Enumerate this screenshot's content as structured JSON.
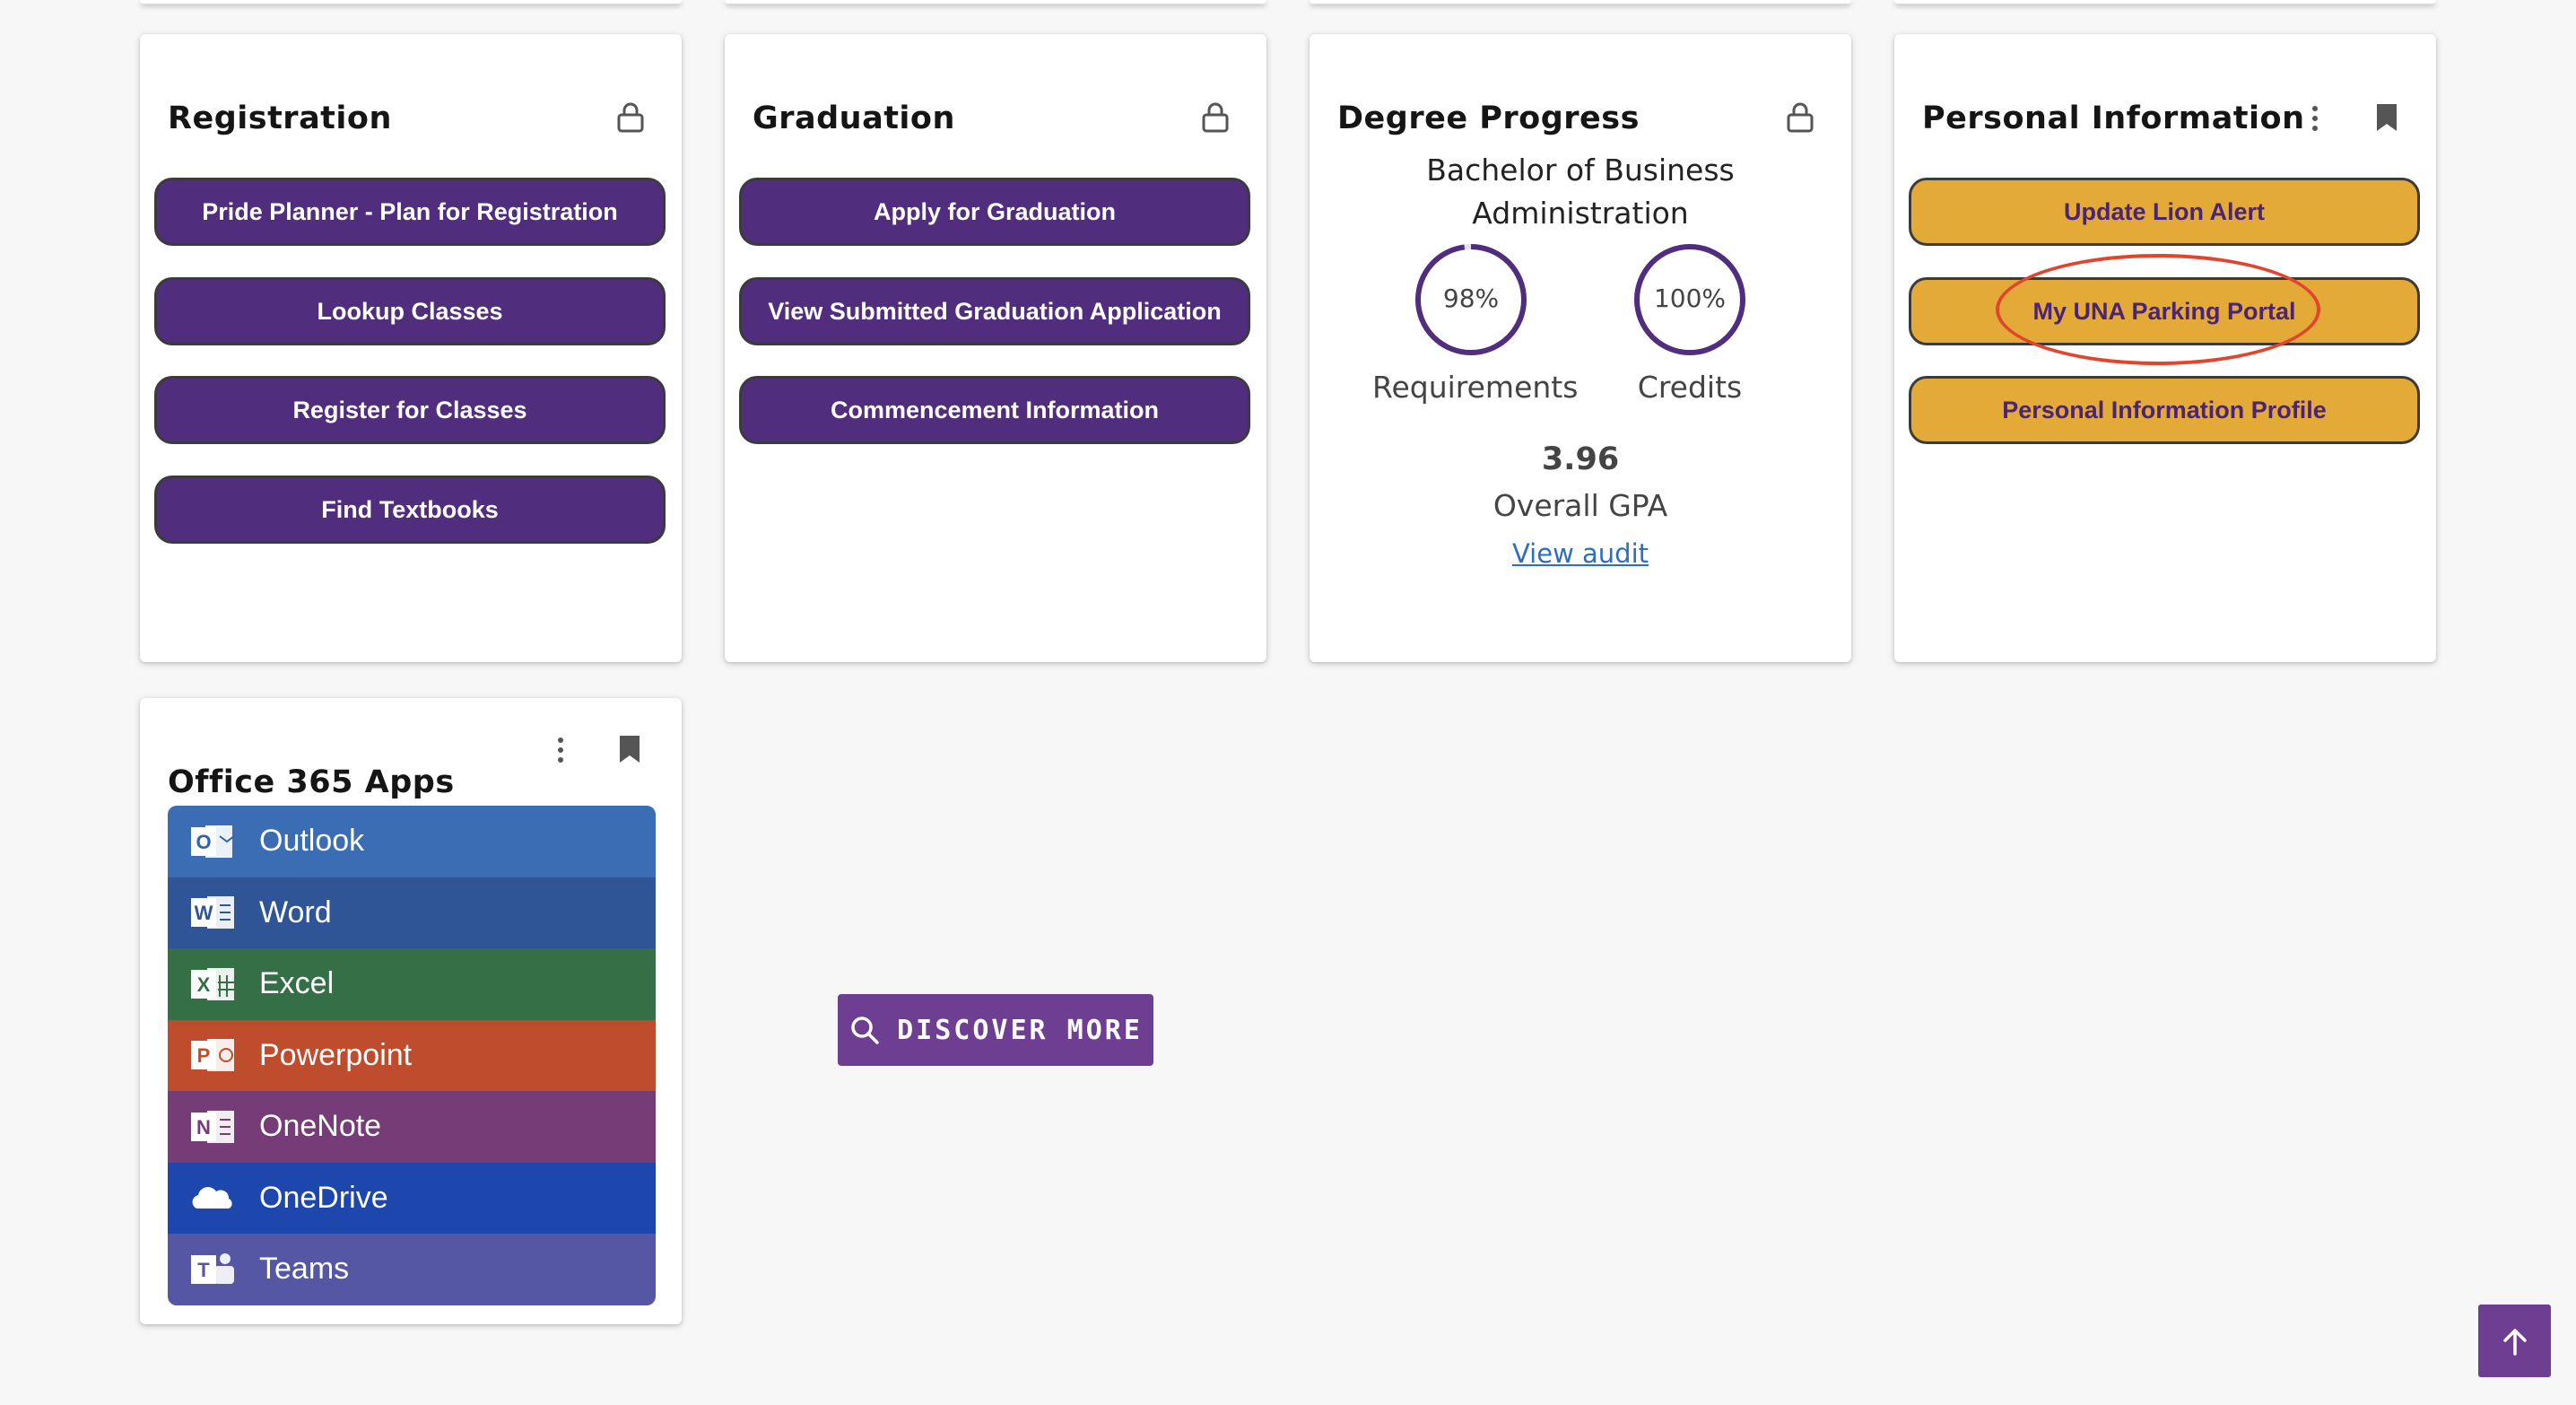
{
  "registration": {
    "title": "Registration",
    "buttons": [
      "Pride Planner - Plan for Registration",
      "Lookup Classes",
      "Register for Classes",
      "Find Textbooks"
    ]
  },
  "graduation": {
    "title": "Graduation",
    "buttons": [
      "Apply for Graduation",
      "View Submitted Graduation Application",
      "Commencement Information"
    ]
  },
  "degree_progress": {
    "title": "Degree Progress",
    "degree_line1": "Bachelor of Business",
    "degree_line2": "Administration",
    "requirements_pct": "98%",
    "requirements_value": 0.98,
    "requirements_label": "Requirements",
    "credits_pct": "100%",
    "credits_value": 1.0,
    "credits_label": "Credits",
    "gpa": "3.96",
    "gpa_label": "Overall GPA",
    "audit_link": "View audit"
  },
  "personal_info": {
    "title": "Personal Information",
    "buttons": [
      "Update Lion Alert",
      "My UNA Parking Portal",
      "Personal Information Profile"
    ]
  },
  "office_apps": {
    "title": "Office 365 Apps",
    "apps": [
      {
        "name": "Outlook",
        "letter": "O",
        "color": "#3a6db3"
      },
      {
        "name": "Word",
        "letter": "W",
        "color": "#2f5596"
      },
      {
        "name": "Excel",
        "letter": "X",
        "color": "#346f45"
      },
      {
        "name": "Powerpoint",
        "letter": "P",
        "color": "#c04c2e"
      },
      {
        "name": "OneNote",
        "letter": "N",
        "color": "#763c77"
      },
      {
        "name": "OneDrive",
        "letter": "",
        "color": "#1e47ad"
      },
      {
        "name": "Teams",
        "letter": "T",
        "color": "#5557a4"
      }
    ]
  },
  "discover_more": "DISCOVER MORE",
  "colors": {
    "purple": "#512d7d",
    "gold": "#e3aa38",
    "accent": "#6d3e91",
    "highlight": "#e0452e"
  },
  "icons": [
    "lock-icon",
    "kebab-menu-icon",
    "bookmark-icon",
    "search-icon",
    "arrow-up-icon"
  ]
}
